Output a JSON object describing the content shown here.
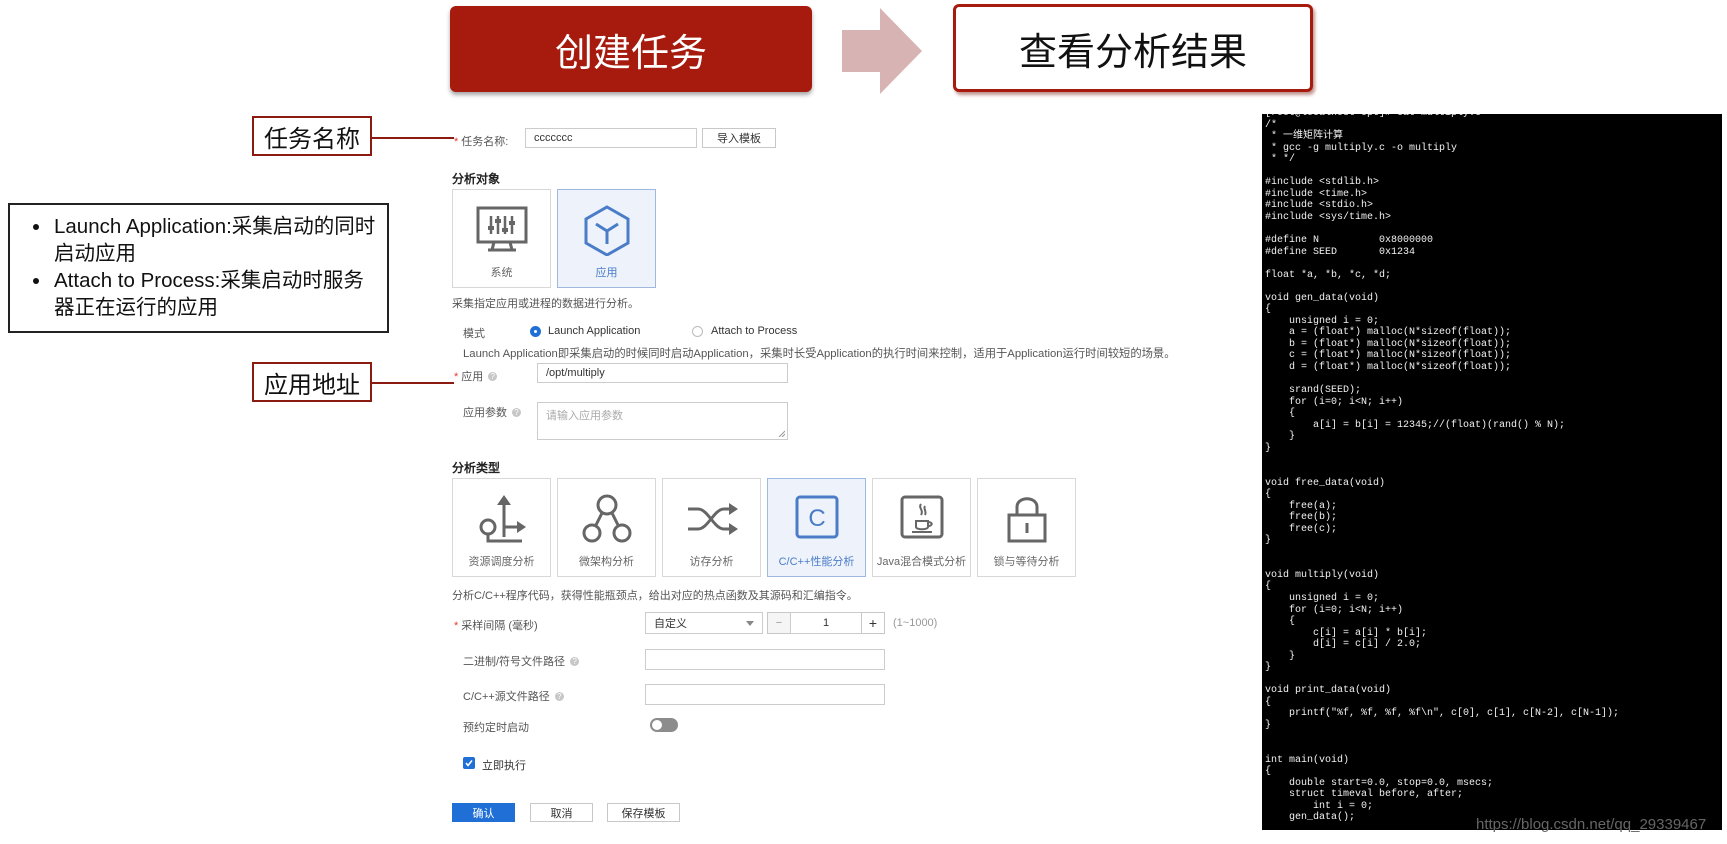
{
  "banner": {
    "step1": "创建任务",
    "step2": "查看分析结果"
  },
  "callouts": {
    "task_name": "任务名称",
    "app_path": "应用地址",
    "notes": [
      "Launch Application:采集启动的同时启动应用",
      "Attach to Process:采集启动时服务器正在运行的应用"
    ]
  },
  "form": {
    "task_name": {
      "label": "任务名称:",
      "value": "ccccccc",
      "import_button": "导入模板"
    },
    "target": {
      "section": "分析对象",
      "tiles": [
        {
          "label": "系统",
          "icon": "system-monitor-icon"
        },
        {
          "label": "应用",
          "icon": "app-cube-icon",
          "selected": true
        }
      ],
      "description": "采集指定应用或进程的数据进行分析。"
    },
    "mode": {
      "label": "模式",
      "options": [
        "Launch Application",
        "Attach to Process"
      ],
      "selected": "Launch Application",
      "description": "Launch Application即采集启动的时候同时启动Application，采集时长受Application的执行时间来控制，适用于Application运行时间较短的场景。"
    },
    "application": {
      "label": "应用",
      "value": "/opt/multiply"
    },
    "app_params": {
      "label": "应用参数",
      "placeholder": "请输入应用参数"
    },
    "analysis_type": {
      "section": "分析类型",
      "tiles": [
        {
          "label": "资源调度分析",
          "icon": "resource-schedule-icon"
        },
        {
          "label": "微架构分析",
          "icon": "microarch-icon"
        },
        {
          "label": "访存分析",
          "icon": "memory-access-icon"
        },
        {
          "label": "C/C++性能分析",
          "icon": "c-language-icon",
          "selected": true
        },
        {
          "label": "Java混合模式分析",
          "icon": "java-icon"
        },
        {
          "label": "锁与等待分析",
          "icon": "lock-icon"
        }
      ],
      "description": "分析C/C++程序代码，获得性能瓶颈点，给出对应的热点函数及其源码和汇编指令。"
    },
    "sampling": {
      "label": "采样间隔 (毫秒)",
      "select_value": "自定义",
      "minus": "−",
      "value": "1",
      "plus": "+",
      "range": "(1~1000)"
    },
    "binary_path": {
      "label": "二进制/符号文件路径"
    },
    "source_path": {
      "label": "C/C++源文件路径"
    },
    "schedule": {
      "label": "预约定时启动",
      "on": false
    },
    "run_now": {
      "label": "立即执行",
      "checked": true
    },
    "buttons": {
      "confirm": "确认",
      "cancel": "取消",
      "save_template": "保存模板"
    }
  },
  "colors": {
    "brand_red": "#a61b0e",
    "primary_blue": "#1f6fd6",
    "selected_tile_bg": "#eef3fb"
  },
  "terminal": {
    "lines": [
      "[root@localhost opt]# cat multiply.c",
      "/*",
      " * 一维矩阵计算",
      " * gcc -g multiply.c -o multiply",
      " * */",
      "",
      "#include <stdlib.h>",
      "#include <time.h>",
      "#include <stdio.h>",
      "#include <sys/time.h>",
      "",
      "#define N          0x8000000",
      "#define SEED       0x1234",
      "",
      "float *a, *b, *c, *d;",
      "",
      "void gen_data(void)",
      "{",
      "    unsigned i = 0;",
      "    a = (float*) malloc(N*sizeof(float));",
      "    b = (float*) malloc(N*sizeof(float));",
      "    c = (float*) malloc(N*sizeof(float));",
      "    d = (float*) malloc(N*sizeof(float));",
      "",
      "    srand(SEED);",
      "    for (i=0; i<N; i++)",
      "    {",
      "        a[i] = b[i] = 12345;//(float)(rand() % N);",
      "    }",
      "}",
      "",
      "",
      "void free_data(void)",
      "{",
      "    free(a);",
      "    free(b);",
      "    free(c);",
      "}",
      "",
      "",
      "void multiply(void)",
      "{",
      "    unsigned i = 0;",
      "    for (i=0; i<N; i++)",
      "    {",
      "        c[i] = a[i] * b[i];",
      "        d[i] = c[i] / 2.0;",
      "    }",
      "}",
      "",
      "void print_data(void)",
      "{",
      "    printf(\"%f, %f, %f, %f\\n\", c[0], c[1], c[N-2], c[N-1]);",
      "}",
      "",
      "",
      "int main(void)",
      "{",
      "    double start=0.0, stop=0.0, msecs;",
      "    struct timeval before, after;",
      "        int i = 0;",
      "    gen_data();"
    ]
  },
  "watermark": "https://blog.csdn.net/qq_29339467"
}
